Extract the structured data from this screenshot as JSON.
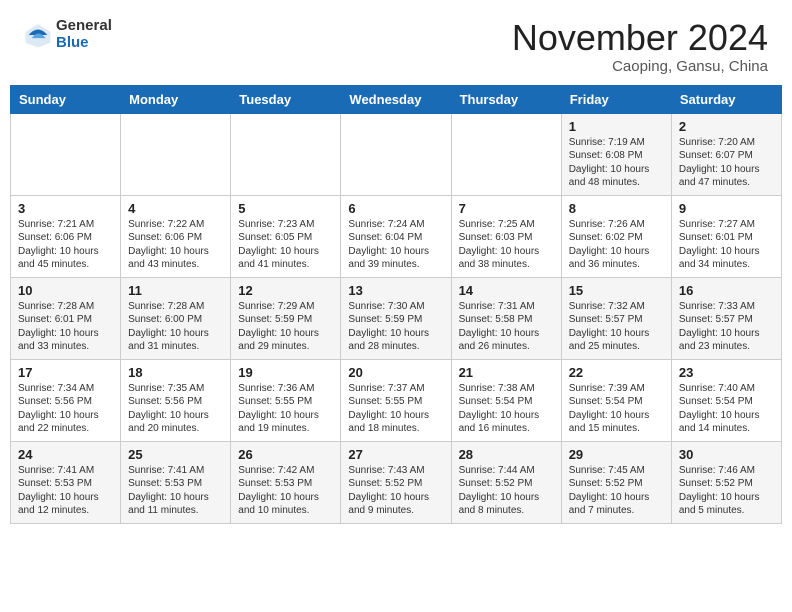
{
  "header": {
    "logo_general": "General",
    "logo_blue": "Blue",
    "month_year": "November 2024",
    "location": "Caoping, Gansu, China"
  },
  "weekdays": [
    "Sunday",
    "Monday",
    "Tuesday",
    "Wednesday",
    "Thursday",
    "Friday",
    "Saturday"
  ],
  "weeks": [
    [
      {
        "day": "",
        "info": ""
      },
      {
        "day": "",
        "info": ""
      },
      {
        "day": "",
        "info": ""
      },
      {
        "day": "",
        "info": ""
      },
      {
        "day": "",
        "info": ""
      },
      {
        "day": "1",
        "info": "Sunrise: 7:19 AM\nSunset: 6:08 PM\nDaylight: 10 hours\nand 48 minutes."
      },
      {
        "day": "2",
        "info": "Sunrise: 7:20 AM\nSunset: 6:07 PM\nDaylight: 10 hours\nand 47 minutes."
      }
    ],
    [
      {
        "day": "3",
        "info": "Sunrise: 7:21 AM\nSunset: 6:06 PM\nDaylight: 10 hours\nand 45 minutes."
      },
      {
        "day": "4",
        "info": "Sunrise: 7:22 AM\nSunset: 6:06 PM\nDaylight: 10 hours\nand 43 minutes."
      },
      {
        "day": "5",
        "info": "Sunrise: 7:23 AM\nSunset: 6:05 PM\nDaylight: 10 hours\nand 41 minutes."
      },
      {
        "day": "6",
        "info": "Sunrise: 7:24 AM\nSunset: 6:04 PM\nDaylight: 10 hours\nand 39 minutes."
      },
      {
        "day": "7",
        "info": "Sunrise: 7:25 AM\nSunset: 6:03 PM\nDaylight: 10 hours\nand 38 minutes."
      },
      {
        "day": "8",
        "info": "Sunrise: 7:26 AM\nSunset: 6:02 PM\nDaylight: 10 hours\nand 36 minutes."
      },
      {
        "day": "9",
        "info": "Sunrise: 7:27 AM\nSunset: 6:01 PM\nDaylight: 10 hours\nand 34 minutes."
      }
    ],
    [
      {
        "day": "10",
        "info": "Sunrise: 7:28 AM\nSunset: 6:01 PM\nDaylight: 10 hours\nand 33 minutes."
      },
      {
        "day": "11",
        "info": "Sunrise: 7:28 AM\nSunset: 6:00 PM\nDaylight: 10 hours\nand 31 minutes."
      },
      {
        "day": "12",
        "info": "Sunrise: 7:29 AM\nSunset: 5:59 PM\nDaylight: 10 hours\nand 29 minutes."
      },
      {
        "day": "13",
        "info": "Sunrise: 7:30 AM\nSunset: 5:59 PM\nDaylight: 10 hours\nand 28 minutes."
      },
      {
        "day": "14",
        "info": "Sunrise: 7:31 AM\nSunset: 5:58 PM\nDaylight: 10 hours\nand 26 minutes."
      },
      {
        "day": "15",
        "info": "Sunrise: 7:32 AM\nSunset: 5:57 PM\nDaylight: 10 hours\nand 25 minutes."
      },
      {
        "day": "16",
        "info": "Sunrise: 7:33 AM\nSunset: 5:57 PM\nDaylight: 10 hours\nand 23 minutes."
      }
    ],
    [
      {
        "day": "17",
        "info": "Sunrise: 7:34 AM\nSunset: 5:56 PM\nDaylight: 10 hours\nand 22 minutes."
      },
      {
        "day": "18",
        "info": "Sunrise: 7:35 AM\nSunset: 5:56 PM\nDaylight: 10 hours\nand 20 minutes."
      },
      {
        "day": "19",
        "info": "Sunrise: 7:36 AM\nSunset: 5:55 PM\nDaylight: 10 hours\nand 19 minutes."
      },
      {
        "day": "20",
        "info": "Sunrise: 7:37 AM\nSunset: 5:55 PM\nDaylight: 10 hours\nand 18 minutes."
      },
      {
        "day": "21",
        "info": "Sunrise: 7:38 AM\nSunset: 5:54 PM\nDaylight: 10 hours\nand 16 minutes."
      },
      {
        "day": "22",
        "info": "Sunrise: 7:39 AM\nSunset: 5:54 PM\nDaylight: 10 hours\nand 15 minutes."
      },
      {
        "day": "23",
        "info": "Sunrise: 7:40 AM\nSunset: 5:54 PM\nDaylight: 10 hours\nand 14 minutes."
      }
    ],
    [
      {
        "day": "24",
        "info": "Sunrise: 7:41 AM\nSunset: 5:53 PM\nDaylight: 10 hours\nand 12 minutes."
      },
      {
        "day": "25",
        "info": "Sunrise: 7:41 AM\nSunset: 5:53 PM\nDaylight: 10 hours\nand 11 minutes."
      },
      {
        "day": "26",
        "info": "Sunrise: 7:42 AM\nSunset: 5:53 PM\nDaylight: 10 hours\nand 10 minutes."
      },
      {
        "day": "27",
        "info": "Sunrise: 7:43 AM\nSunset: 5:52 PM\nDaylight: 10 hours\nand 9 minutes."
      },
      {
        "day": "28",
        "info": "Sunrise: 7:44 AM\nSunset: 5:52 PM\nDaylight: 10 hours\nand 8 minutes."
      },
      {
        "day": "29",
        "info": "Sunrise: 7:45 AM\nSunset: 5:52 PM\nDaylight: 10 hours\nand 7 minutes."
      },
      {
        "day": "30",
        "info": "Sunrise: 7:46 AM\nSunset: 5:52 PM\nDaylight: 10 hours\nand 5 minutes."
      }
    ]
  ]
}
